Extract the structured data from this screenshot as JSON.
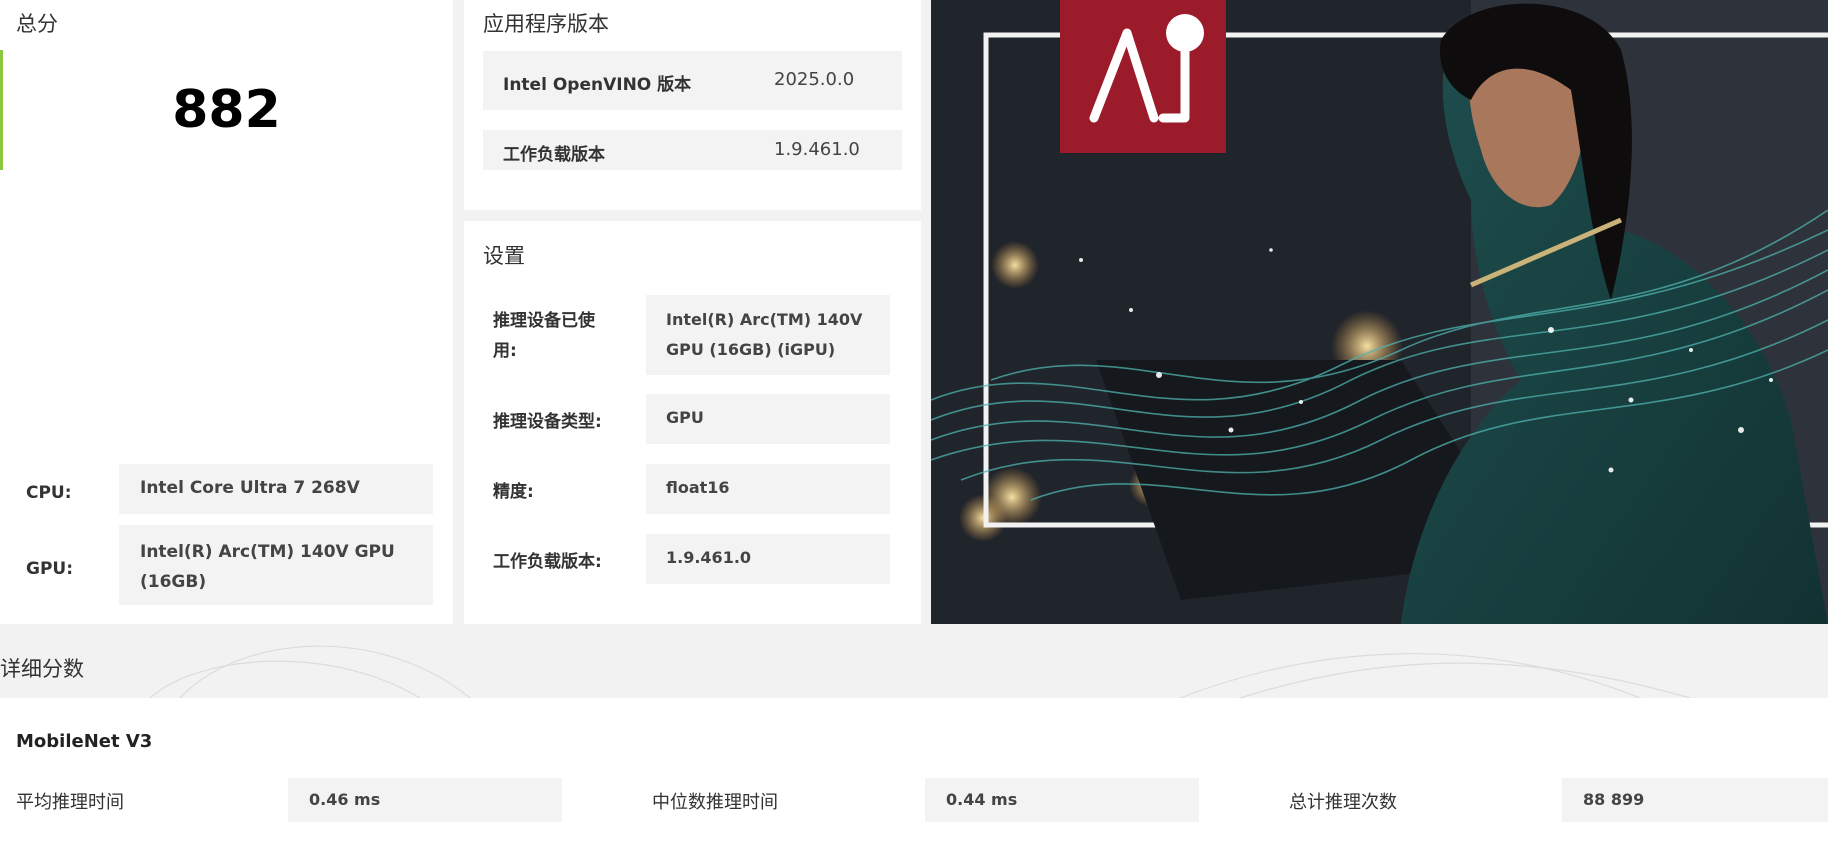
{
  "score": {
    "title": "总分",
    "value": "882"
  },
  "system": [
    {
      "label": "CPU:",
      "value": "Intel Core Ultra 7 268V"
    },
    {
      "label": "GPU:",
      "value": "Intel(R) Arc(TM) 140V GPU (16GB)"
    }
  ],
  "version": {
    "title": "应用程序版本",
    "rows": [
      {
        "label": "Intel OpenVINO 版本",
        "value": "2025.0.0"
      },
      {
        "label": "工作负载版本",
        "value": "1.9.461.0"
      }
    ]
  },
  "settings": {
    "title": "设置",
    "rows": [
      {
        "label": "推理设备已使用:",
        "value": "Intel(R) Arc(TM) 140V GPU (16GB) (iGPU)"
      },
      {
        "label": "推理设备类型:",
        "value": "GPU"
      },
      {
        "label": "精度:",
        "value": "float16"
      },
      {
        "label": "工作负载版本:",
        "value": "1.9.461.0"
      }
    ]
  },
  "hero": {
    "logo_text": "Ai",
    "logo_color": "#9b1b2a",
    "wave_color": "#4fb3b0"
  },
  "details": {
    "title": "详细分数",
    "model": "MobileNet V3",
    "metrics": [
      {
        "label": "平均推理时间",
        "value": "0.46 ms"
      },
      {
        "label": "中位数推理时间",
        "value": "0.44 ms"
      },
      {
        "label": "总计推理次数",
        "value": "88 899"
      }
    ]
  }
}
